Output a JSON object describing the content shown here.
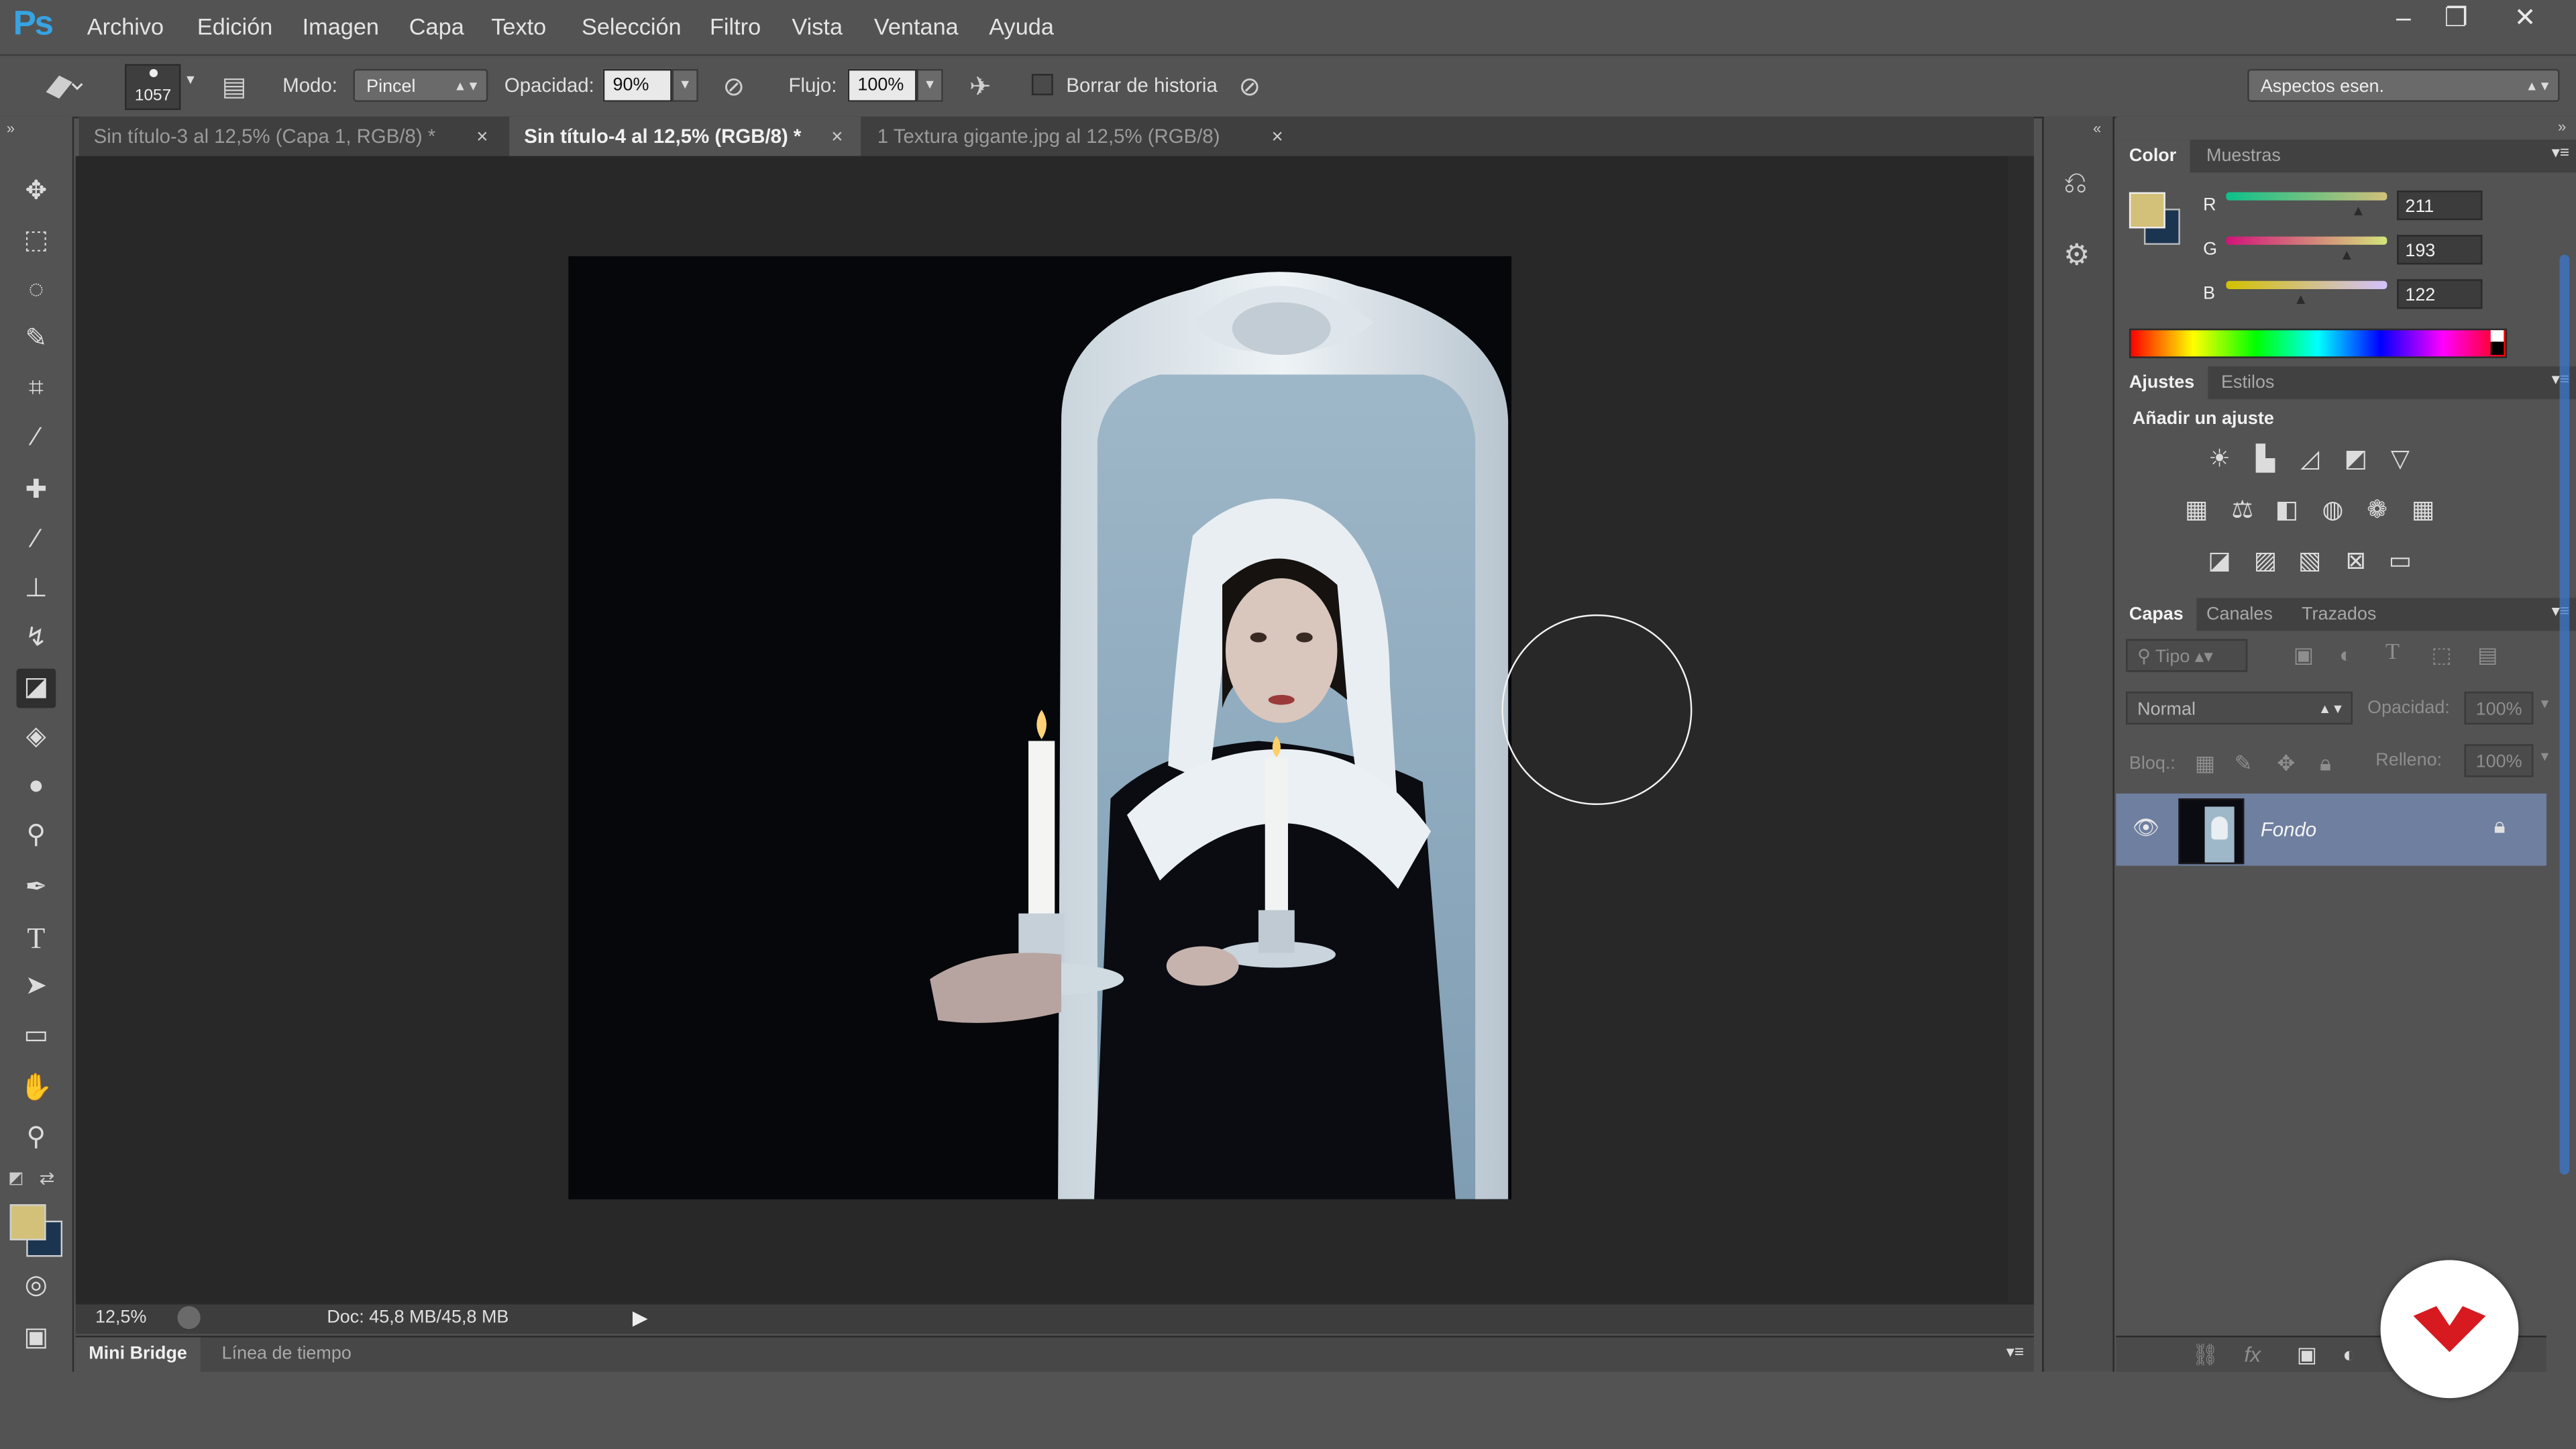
{
  "app": {
    "logo": "Ps"
  },
  "menu": [
    "Archivo",
    "Edición",
    "Imagen",
    "Capa",
    "Texto",
    "Selección",
    "Filtro",
    "Vista",
    "Ventana",
    "Ayuda"
  ],
  "window_controls": {
    "minimize": "–",
    "restore": "❐",
    "close": "✕"
  },
  "options": {
    "brush_size": "1057",
    "mode_label": "Modo:",
    "mode_value": "Pincel",
    "opacity_label": "Opacidad:",
    "opacity_value": "90%",
    "flow_label": "Flujo:",
    "flow_value": "100%",
    "erase_history_label": "Borrar de historia",
    "workspace": "Aspectos esen."
  },
  "tabs": [
    {
      "label": "Sin título-3 al 12,5% (Capa 1, RGB/8) *",
      "active": false
    },
    {
      "label": "Sin título-4 al 12,5% (RGB/8) *",
      "active": true
    },
    {
      "label": "1 Textura gigante.jpg al 12,5% (RGB/8)",
      "active": false
    }
  ],
  "status": {
    "zoom": "12,5%",
    "doc": "Doc: 45,8 MB/45,8 MB"
  },
  "bottom_tabs": {
    "mini_bridge": "Mini Bridge",
    "timeline": "Línea de tiempo"
  },
  "color_panel": {
    "tabs": [
      "Color",
      "Muestras"
    ],
    "r_label": "R",
    "g_label": "G",
    "b_label": "B",
    "r": "211",
    "g": "193",
    "b": "122",
    "foreground": "#d3c17a",
    "background": "#1b3550"
  },
  "adjust_panel": {
    "tabs": [
      "Ajustes",
      "Estilos"
    ],
    "heading": "Añadir un ajuste"
  },
  "layers_panel": {
    "tabs": [
      "Capas",
      "Canales",
      "Trazados"
    ],
    "filter": "Tipo",
    "blend": "Normal",
    "opacity_label": "Opacidad:",
    "opacity_value": "100%",
    "lock_label": "Bloq.:",
    "fill_label": "Relleno:",
    "fill_value": "100%",
    "layer_name": "Fondo"
  },
  "colors": {
    "accent_logo": "#36a3e3",
    "watermark": "#d71920"
  }
}
